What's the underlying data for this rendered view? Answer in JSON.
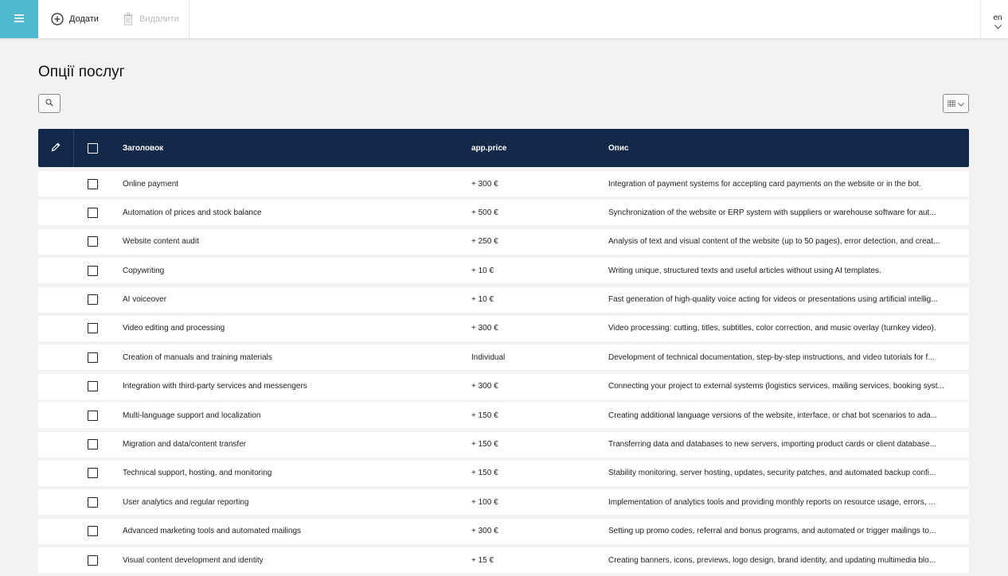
{
  "toolbar": {
    "add_label": "Додати",
    "delete_label": "Видалити",
    "language": "en"
  },
  "page": {
    "title": "Опції послуг"
  },
  "table": {
    "headers": {
      "title": "Заголовок",
      "price": "app.price",
      "description": "Опис"
    },
    "rows": [
      {
        "title": "Online payment",
        "price": "+ 300 €",
        "description": "Integration of payment systems for accepting card payments on the website or in the bot."
      },
      {
        "title": "Automation of prices and stock balance",
        "price": "+ 500 €",
        "description": "Synchronization of the website or ERP system with suppliers or warehouse software for aut..."
      },
      {
        "title": "Website content audit",
        "price": "+ 250 €",
        "description": "Analysis of text and visual content of the website (up to 50 pages), error detection, and creat..."
      },
      {
        "title": "Copywriting",
        "price": "+ 10 €",
        "description": "Writing unique, structured texts and useful articles without using AI templates."
      },
      {
        "title": "AI voiceover",
        "price": "+ 10 €",
        "description": "Fast generation of high-quality voice acting for videos or presentations using artificial intellig..."
      },
      {
        "title": "Video editing and processing",
        "price": "+ 300 €",
        "description": "Video processing: cutting, titles, subtitles, color correction, and music overlay (turnkey video)."
      },
      {
        "title": "Creation of manuals and training materials",
        "price": "Individual",
        "description": "Development of technical documentation, step-by-step instructions, and video tutorials for f..."
      },
      {
        "title": "Integration with third-party services and messengers",
        "price": "+ 300 €",
        "description": "Connecting your project to external systems (logistics services, mailing services, booking syst..."
      },
      {
        "title": "Multi-language support and localization",
        "price": "+ 150 €",
        "description": "Creating additional language versions of the website, interface, or chat bot scenarios to ada..."
      },
      {
        "title": "Migration and data/content transfer",
        "price": "+ 150 €",
        "description": "Transferring data and databases to new servers, importing product cards or client database..."
      },
      {
        "title": "Technical support, hosting, and monitoring",
        "price": "+ 150 €",
        "description": "Stability monitoring, server hosting, updates, security patches, and automated backup confi..."
      },
      {
        "title": "User analytics and regular reporting",
        "price": "+ 100 €",
        "description": "Implementation of analytics tools and providing monthly reports on resource usage, errors, ..."
      },
      {
        "title": "Advanced marketing tools and automated mailings",
        "price": "+ 300 €",
        "description": "Setting up promo codes, referral and bonus programs, and automated or trigger mailings to..."
      },
      {
        "title": "Visual content development and identity",
        "price": "+ 15 €",
        "description": "Creating banners, icons, previews, logo design, brand identity, and updating multimedia blo..."
      }
    ]
  },
  "colors": {
    "accent": "#4fb8cf",
    "header_bg": "#13294a",
    "page_bg": "#f2f2f2"
  },
  "icons": [
    "menu-icon",
    "plus-circle-icon",
    "trash-icon",
    "chevron-down-icon",
    "search-icon",
    "grid-icon",
    "pencil-icon"
  ]
}
